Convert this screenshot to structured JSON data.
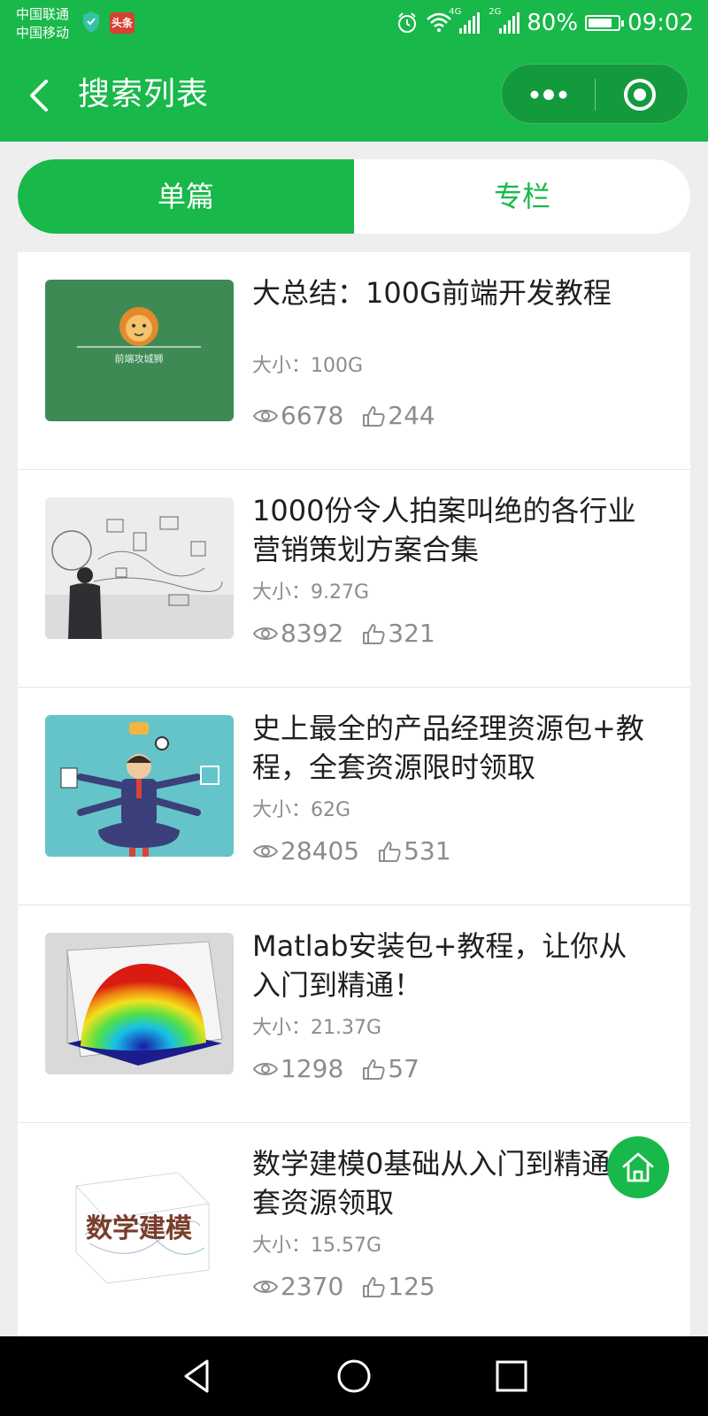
{
  "status_bar": {
    "carrier1": "中国联通",
    "carrier2": "中国移动",
    "toutiao_badge": "头条",
    "net1": "4G",
    "net2": "2G",
    "battery_text": "80%",
    "battery_level": 0.8,
    "time": "09:02"
  },
  "nav": {
    "title": "搜索列表"
  },
  "tabs": [
    {
      "label": "单篇",
      "active": true
    },
    {
      "label": "专栏",
      "active": false
    }
  ],
  "items": [
    {
      "title": "大总结：100G前端开发教程",
      "size": "大小：100G",
      "views": "6678",
      "likes": "244",
      "thumb_caption": "前端攻城狮"
    },
    {
      "title": "1000份令人拍案叫绝的各行业营销策划方案合集",
      "size": "大小：9.27G",
      "views": "8392",
      "likes": "321"
    },
    {
      "title": "史上最全的产品经理资源包+教程，全套资源限时领取",
      "size": "大小：62G",
      "views": "28405",
      "likes": "531"
    },
    {
      "title": "Matlab安装包+教程，让你从入门到精通！",
      "size": "大小：21.37G",
      "views": "1298",
      "likes": "57"
    },
    {
      "title": "数学建模0基础从入门到精通全套资源领取",
      "size": "大小：15.57G",
      "views": "2370",
      "likes": "125",
      "thumb_caption": "数学建模"
    }
  ],
  "colors": {
    "brand_green": "#19b84a",
    "muted_text": "#8c8c8c"
  },
  "icons": {
    "back": "chevron-left-icon",
    "more": "more-dots-icon",
    "close": "target-icon",
    "view": "eye-icon",
    "like": "thumbs-up-icon",
    "home": "home-icon"
  }
}
